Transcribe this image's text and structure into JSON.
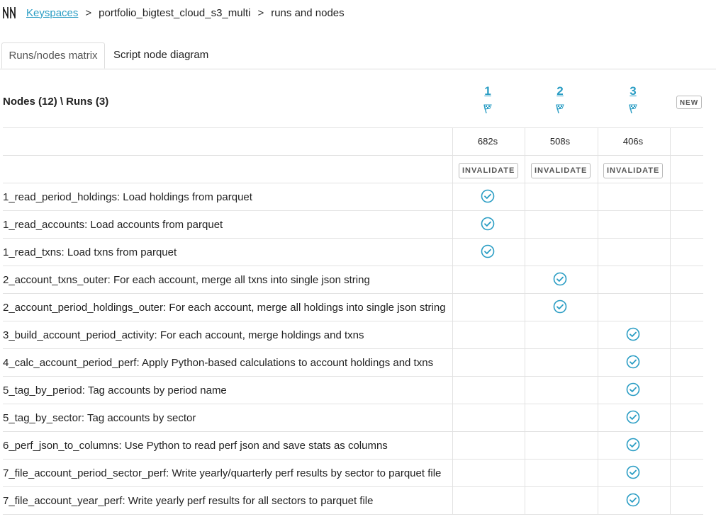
{
  "breadcrumb": {
    "root_link": "Keyspaces",
    "separator": ">",
    "keyspace": "portfolio_bigtest_cloud_s3_multi",
    "page": "runs and nodes"
  },
  "tabs": [
    {
      "label": "Runs/nodes matrix",
      "active": true
    },
    {
      "label": "Script node diagram",
      "active": false
    }
  ],
  "matrix": {
    "header_label": "Nodes (12) \\ Runs (3)",
    "new_label": "NEW",
    "invalidate_label": "INVALIDATE",
    "runs": [
      {
        "id": "1",
        "duration": "682s"
      },
      {
        "id": "2",
        "duration": "508s"
      },
      {
        "id": "3",
        "duration": "406s"
      }
    ],
    "nodes": [
      {
        "label": "1_read_period_holdings: Load holdings from parquet",
        "run": 1
      },
      {
        "label": "1_read_accounts: Load accounts from parquet",
        "run": 1
      },
      {
        "label": "1_read_txns: Load txns from parquet",
        "run": 1
      },
      {
        "label": "2_account_txns_outer: For each account, merge all txns into single json string",
        "run": 2
      },
      {
        "label": "2_account_period_holdings_outer: For each account, merge all holdings into single json string",
        "run": 2
      },
      {
        "label": "3_build_account_period_activity: For each account, merge holdings and txns",
        "run": 3
      },
      {
        "label": "4_calc_account_period_perf: Apply Python-based calculations to account holdings and txns",
        "run": 3
      },
      {
        "label": "5_tag_by_period: Tag accounts by period name",
        "run": 3
      },
      {
        "label": "5_tag_by_sector: Tag accounts by sector",
        "run": 3
      },
      {
        "label": "6_perf_json_to_columns: Use Python to read perf json and save stats as columns",
        "run": 3
      },
      {
        "label": "7_file_account_period_sector_perf: Write yearly/quarterly perf results by sector to parquet file",
        "run": 3
      },
      {
        "label": "7_file_account_year_perf: Write yearly perf results for all sectors to parquet file",
        "run": 3
      }
    ],
    "status_icon": "check-circle-icon",
    "flag_icon": "checkered-flag-icon"
  },
  "colors": {
    "accent": "#2a9dc4",
    "border": "#e2e2e2"
  }
}
